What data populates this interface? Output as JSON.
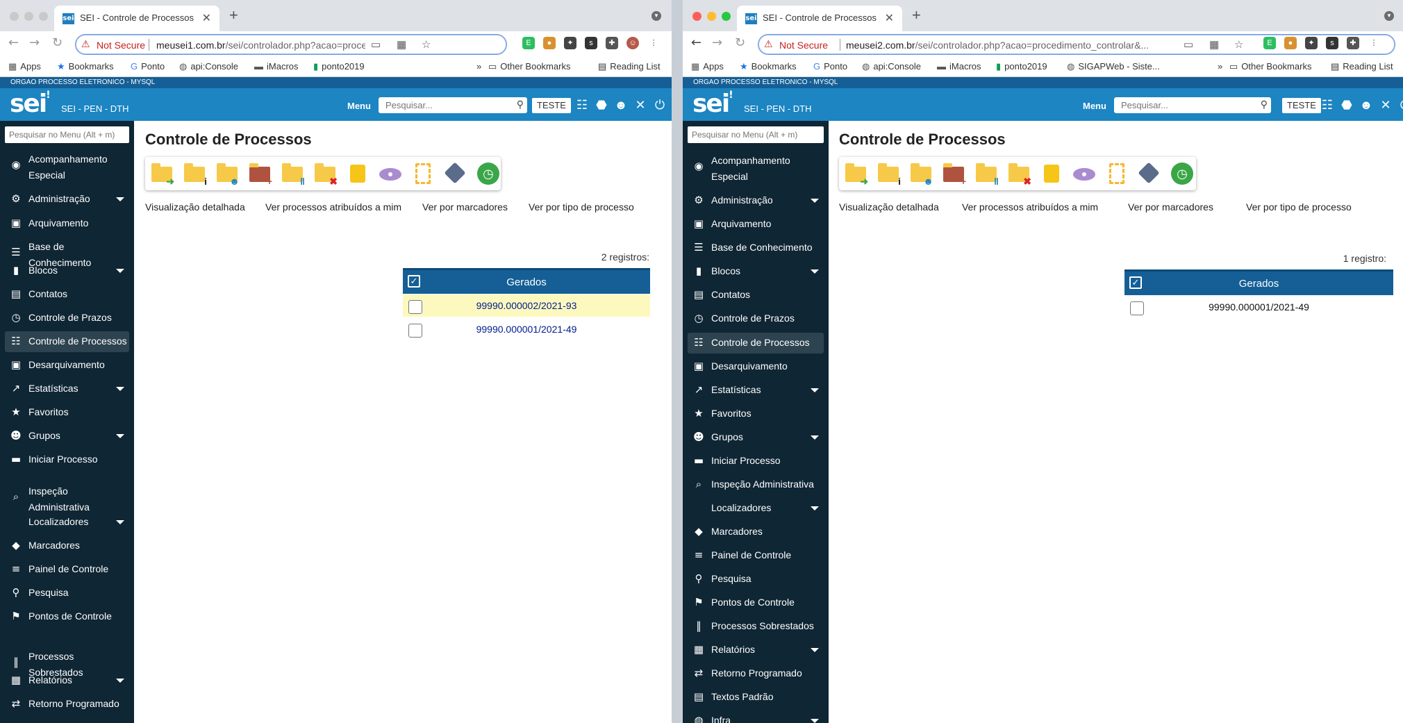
{
  "w1": {
    "tab_title": "SEI - Controle de Processos",
    "not_secure": "Not Secure",
    "url_host": "meusei1.com.br",
    "url_path": "/sei/controlador.php?acao=procedimento_...",
    "bookmarks": [
      "Apps",
      "Bookmarks",
      "Ponto",
      "api:Console",
      "iMacros",
      "ponto2019"
    ],
    "other_bookmarks": "Other Bookmarks",
    "reading_list": "Reading List",
    "org": "ORGAO PROCESSO ELETRONICO - MYSQL",
    "subtitle": "SEI - PEN - DTH",
    "menu_label": "Menu",
    "search_placeholder": "Pesquisar...",
    "teste": "TESTE",
    "menu_search_placeholder": "Pesquisar no Menu (Alt + m)",
    "sidebar": [
      {
        "l1": "Acompanhamento",
        "l2": "Especial",
        "icon": "eye-icon",
        "g": "◉"
      },
      {
        "l1": "Administração",
        "icon": "gears-icon",
        "g": "⚙",
        "caret": true
      },
      {
        "l1": "Arquivamento",
        "icon": "archive-icon",
        "g": "▣"
      },
      {
        "l1": "Base de",
        "l2": "Conhecimento",
        "icon": "database-icon",
        "g": "☰"
      },
      {
        "l1": "Blocos",
        "icon": "blocks-icon",
        "g": "▮",
        "caret": true
      },
      {
        "l1": "Contatos",
        "icon": "contacts-icon",
        "g": "▤"
      },
      {
        "l1": "Controle de Prazos",
        "icon": "clock-icon",
        "g": "◷"
      },
      {
        "l1": "Controle de Processos",
        "icon": "list-icon",
        "g": "☷",
        "active": true
      },
      {
        "l1": "Desarquivamento",
        "icon": "unarchive-icon",
        "g": "▣"
      },
      {
        "l1": "Estatísticas",
        "icon": "chart-icon",
        "g": "↗",
        "caret": true
      },
      {
        "l1": "Favoritos",
        "icon": "star-icon",
        "g": "★"
      },
      {
        "l1": "Grupos",
        "icon": "group-icon",
        "g": "☻",
        "caret": true
      },
      {
        "l1": "Iniciar Processo",
        "icon": "folder-icon",
        "g": "▬"
      },
      {
        "l1": "Inspeção",
        "l2": "Administrativa",
        "icon": "inspection-icon",
        "g": "⌕"
      },
      {
        "l1": "Localizadores",
        "icon": "none",
        "g": "",
        "caret": true
      },
      {
        "l1": "Marcadores",
        "icon": "tag-icon",
        "g": "◆"
      },
      {
        "l1": "Painel de Controle",
        "icon": "panel-icon",
        "g": "≡"
      },
      {
        "l1": "Pesquisa",
        "icon": "search-icon",
        "g": "⚲"
      },
      {
        "l1": "Pontos de Controle",
        "icon": "flag-icon",
        "g": "⚑"
      },
      {
        "l1": "Processos",
        "l2": "Sobrestados",
        "icon": "pause-icon",
        "g": "‖"
      },
      {
        "l1": "Relatórios",
        "icon": "table-icon",
        "g": "▦",
        "caret": true
      },
      {
        "l1": "Retorno Programado",
        "icon": "return-icon",
        "g": "⇄"
      }
    ],
    "page_title": "Controle de Processos",
    "links": [
      "Visualização detalhada",
      "Ver processos atribuídos a mim",
      "Ver por marcadores",
      "Ver por tipo de processo"
    ],
    "registros": "2 registros:",
    "table_header": "Gerados",
    "rows": [
      "99990.000002/2021-93",
      "99990.000001/2021-49"
    ]
  },
  "w2": {
    "tab_title": "SEI - Controle de Processos",
    "not_secure": "Not Secure",
    "url_host": "meusei2.com.br",
    "url_path": "/sei/controlador.php?acao=procedimento_controlar&...",
    "bookmarks": [
      "Apps",
      "Bookmarks",
      "Ponto",
      "api:Console",
      "iMacros",
      "ponto2019",
      "SIGAPWeb - Siste..."
    ],
    "other_bookmarks": "Other Bookmarks",
    "reading_list": "Reading List",
    "org": "ORGAO PROCESSO ELETRONICO - MYSQL",
    "subtitle": "SEI - PEN - DTH",
    "menu_label": "Menu",
    "search_placeholder": "Pesquisar...",
    "teste": "TESTE",
    "menu_search_placeholder": "Pesquisar no Menu (Alt + m)",
    "sidebar": [
      {
        "l1": "Acompanhamento",
        "l2": "Especial",
        "icon": "eye-icon",
        "g": "◉"
      },
      {
        "l1": "Administração",
        "icon": "gears-icon",
        "g": "⚙",
        "caret": true
      },
      {
        "l1": "Arquivamento",
        "icon": "archive-icon",
        "g": "▣"
      },
      {
        "l1": "Base de Conhecimento",
        "icon": "database-icon",
        "g": "☰"
      },
      {
        "l1": "Blocos",
        "icon": "blocks-icon",
        "g": "▮",
        "caret": true
      },
      {
        "l1": "Contatos",
        "icon": "contacts-icon",
        "g": "▤"
      },
      {
        "l1": "Controle de Prazos",
        "icon": "clock-icon",
        "g": "◷"
      },
      {
        "l1": "Controle de Processos",
        "icon": "list-icon",
        "g": "☷",
        "active": true
      },
      {
        "l1": "Desarquivamento",
        "icon": "unarchive-icon",
        "g": "▣"
      },
      {
        "l1": "Estatísticas",
        "icon": "chart-icon",
        "g": "↗",
        "caret": true
      },
      {
        "l1": "Favoritos",
        "icon": "star-icon",
        "g": "★"
      },
      {
        "l1": "Grupos",
        "icon": "group-icon",
        "g": "☻",
        "caret": true
      },
      {
        "l1": "Iniciar Processo",
        "icon": "folder-icon",
        "g": "▬"
      },
      {
        "l1": "Inspeção Administrativa",
        "icon": "inspection-icon",
        "g": "⌕"
      },
      {
        "l1": "Localizadores",
        "icon": "none",
        "g": "",
        "caret": true
      },
      {
        "l1": "Marcadores",
        "icon": "tag-icon",
        "g": "◆"
      },
      {
        "l1": "Painel de Controle",
        "icon": "panel-icon",
        "g": "≡"
      },
      {
        "l1": "Pesquisa",
        "icon": "search-icon",
        "g": "⚲"
      },
      {
        "l1": "Pontos de Controle",
        "icon": "flag-icon",
        "g": "⚑"
      },
      {
        "l1": "Processos Sobrestados",
        "icon": "pause-icon",
        "g": "‖"
      },
      {
        "l1": "Relatórios",
        "icon": "table-icon",
        "g": "▦",
        "caret": true
      },
      {
        "l1": "Retorno Programado",
        "icon": "return-icon",
        "g": "⇄"
      },
      {
        "l1": "Textos Padrão",
        "icon": "document-icon",
        "g": "▤"
      },
      {
        "l1": "Infra",
        "icon": "infra-icon",
        "g": "◍",
        "caret": true
      }
    ],
    "page_title": "Controle de Processos",
    "links": [
      "Visualização detalhada",
      "Ver processos atribuídos a mim",
      "Ver por marcadores",
      "Ver por tipo de processo"
    ],
    "registros": "1 registro:",
    "table_header": "Gerados",
    "rows": [
      "99990.000001/2021-49"
    ]
  },
  "toolbar_icons": [
    "new-process-icon",
    "process-info-icon",
    "assign-process-icon",
    "attach-process-icon",
    "suspend-process-icon",
    "close-process-icon",
    "note-icon",
    "follow-icon",
    "document-model-icon",
    "add-marker-icon",
    "deadline-icon"
  ],
  "colors": {
    "header": "#1c85c2",
    "strip": "#155f96",
    "sidebar": "#0f2634",
    "row_highlight": "#fdf9be",
    "link": "#001a8c"
  }
}
